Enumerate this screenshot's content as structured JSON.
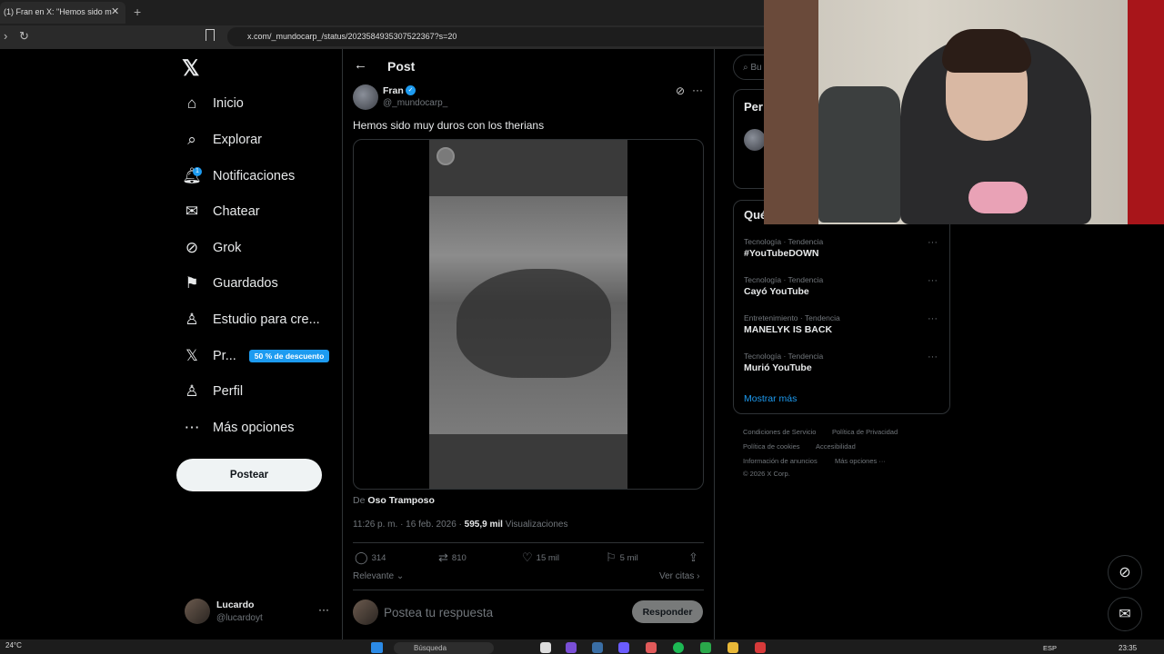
{
  "browser": {
    "tab_title": "(1) Fran en X: \"Hemos sido m",
    "tab_close": "✕",
    "new_tab": "+",
    "url": "x.com/_mundocarp_/status/2023584935307522367?s=20"
  },
  "sidebar": {
    "logo": "𝕏",
    "items": [
      {
        "label": "Inicio",
        "icon": "home-icon",
        "glyph": "⌂"
      },
      {
        "label": "Explorar",
        "icon": "search-icon",
        "glyph": "⌕"
      },
      {
        "label": "Notificaciones",
        "icon": "bell-icon",
        "glyph": "♪",
        "badge": "1"
      },
      {
        "label": "Chatear",
        "icon": "mail-icon",
        "glyph": "✉"
      },
      {
        "label": "Grok",
        "icon": "grok-icon",
        "glyph": "⊘"
      },
      {
        "label": "Guardados",
        "icon": "bookmark-icon",
        "glyph": "⚑"
      },
      {
        "label": "Estudio para cre...",
        "icon": "studio-icon",
        "glyph": "♙"
      },
      {
        "label": "Pr...",
        "icon": "x-premium-icon",
        "glyph": "𝕏",
        "badge": "50 % de descuento"
      },
      {
        "label": "Perfil",
        "icon": "profile-icon",
        "glyph": "♙"
      },
      {
        "label": "Más opciones",
        "icon": "more-options-icon",
        "glyph": "⋯"
      }
    ],
    "post_button": "Postear",
    "account": {
      "name": "Lucardo",
      "handle": "@lucardoyt",
      "more": "···"
    }
  },
  "post": {
    "header_title": "Post",
    "back": "←",
    "author": {
      "name": "Fran",
      "handle": "@_mundocarp_",
      "verified": "✓"
    },
    "text": "Hemos sido muy duros con los therians",
    "source_prefix": "De",
    "source_name": "Oso Tramposo",
    "time": "11:26 p. m. · 16 feb. 2026 · ",
    "views": "595,9 mil",
    "views_label": " Visualizaciones",
    "actions": {
      "replies": "314",
      "reposts": "810",
      "likes": "15 mil",
      "bookmarks": "5 mil"
    },
    "sort": "Relevante",
    "quotes": "Ver citas",
    "reply_placeholder": "Postea tu respuesta",
    "reply_button": "Responder"
  },
  "right": {
    "search_placeholder": "Bu",
    "persons_title": "Per",
    "trends_title": "Qué",
    "trends": [
      {
        "category": "Tecnología · Tendencia",
        "name": "#YouTubeDOWN"
      },
      {
        "category": "Tecnología · Tendencia",
        "name": "Cayó YouTube"
      },
      {
        "category": "Entretenimiento · Tendencia",
        "name": "MANELYK IS BACK"
      },
      {
        "category": "Tecnología · Tendencia",
        "name": "Murió YouTube"
      }
    ],
    "show_more": "Mostrar más",
    "footer": {
      "terms": "Condiciones de Servicio",
      "privacy": "Política de Privacidad",
      "cookies": "Política de cookies",
      "accessibility": "Accesibilidad",
      "ads": "Información de anuncios",
      "more": "Más opciones ···",
      "copyright": "© 2026 X Corp."
    }
  },
  "taskbar": {
    "temperature": "24°C",
    "search": "Búsqueda",
    "language": "ESP",
    "time": "23:35"
  },
  "colors": {
    "accent": "#1d9bf0",
    "background": "#000000",
    "muted": "#71767b",
    "border": "#2f3336"
  }
}
